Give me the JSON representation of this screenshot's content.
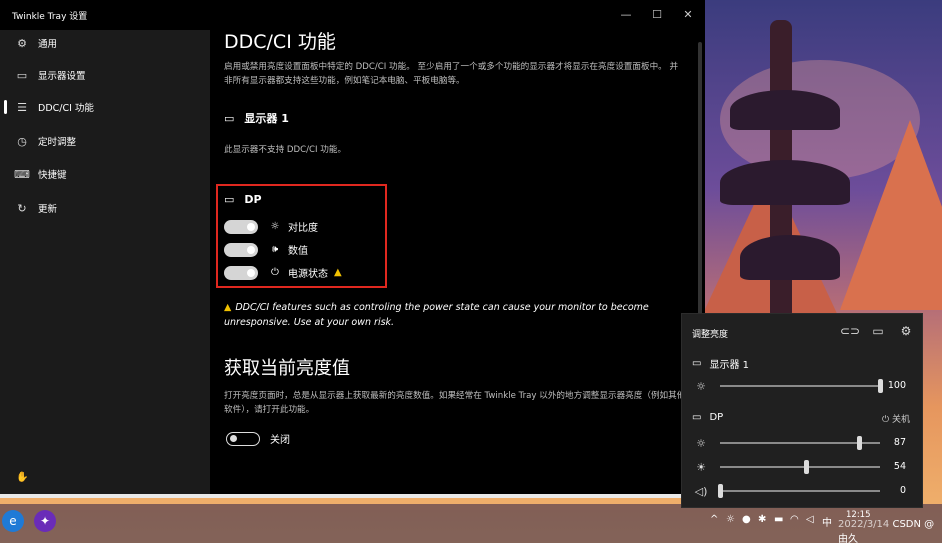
{
  "window": {
    "title": "Twinkle Tray 设置",
    "controls": {
      "minimize": "—",
      "maximize": "☐",
      "close": "✕"
    }
  },
  "sidebar": {
    "items": [
      {
        "label": "通用",
        "icon": "gear-icon",
        "glyph": "⚙",
        "active": false
      },
      {
        "label": "显示器设置",
        "icon": "monitor-icon",
        "glyph": "▭",
        "active": false
      },
      {
        "label": "DDC/CI 功能",
        "icon": "sliders-icon",
        "glyph": "☰",
        "active": true
      },
      {
        "label": "定时调整",
        "icon": "clock-icon",
        "glyph": "◷",
        "active": false
      },
      {
        "label": "快捷键",
        "icon": "keyboard-icon",
        "glyph": "⌨",
        "active": false
      },
      {
        "label": "更新",
        "icon": "refresh-icon",
        "glyph": "↻",
        "active": false
      }
    ]
  },
  "main": {
    "page_title": "DDC/CI 功能",
    "intro": "启用或禁用亮度设置面板中特定的 DDC/CI 功能。 至少启用了一个或多个功能的显示器才将显示在亮度设置面板中。 并非所有显示器都支持这些功能，例如笔记本电脑、平板电脑等。",
    "monitor1": {
      "name": "显示器 1",
      "note": "此显示器不支持 DDC/CI 功能。"
    },
    "dp": {
      "name": "DP",
      "features": [
        {
          "label": "对比度",
          "icon": "sun-icon",
          "glyph": "☼",
          "enabled": true,
          "warning": false
        },
        {
          "label": "数值",
          "icon": "volume-icon",
          "glyph": "🕪",
          "enabled": true,
          "warning": false
        },
        {
          "label": "电源状态",
          "icon": "power-icon",
          "glyph": "⏻",
          "enabled": true,
          "warning": true
        }
      ]
    },
    "warning_text": "DDC/CI features such as controling the power state can cause your monitor to become unresponsive. Use at your own risk.",
    "brightness_section": {
      "title": "获取当前亮度值",
      "desc": "打开亮度页面时，总是从显示器上获取最新的亮度数值。如果经常在 Twinkle Tray 以外的地方调整显示器亮度（例如其他软件），请打开此功能。",
      "toggle_label": "关闭",
      "enabled": false
    }
  },
  "flyout": {
    "title": "调整亮度",
    "header_icons": [
      "link-icon",
      "monitor-off-icon",
      "gear-icon"
    ],
    "monitor1": {
      "name": "显示器 1",
      "brightness": 100
    },
    "dp": {
      "name": "DP",
      "power_label": "关机",
      "brightness": 87,
      "contrast": 54,
      "volume": 0
    }
  },
  "taskbar": {
    "tray_ime": "中",
    "time": "12:15",
    "date": "2022/3/14",
    "watermark": "CSDN @由久"
  }
}
